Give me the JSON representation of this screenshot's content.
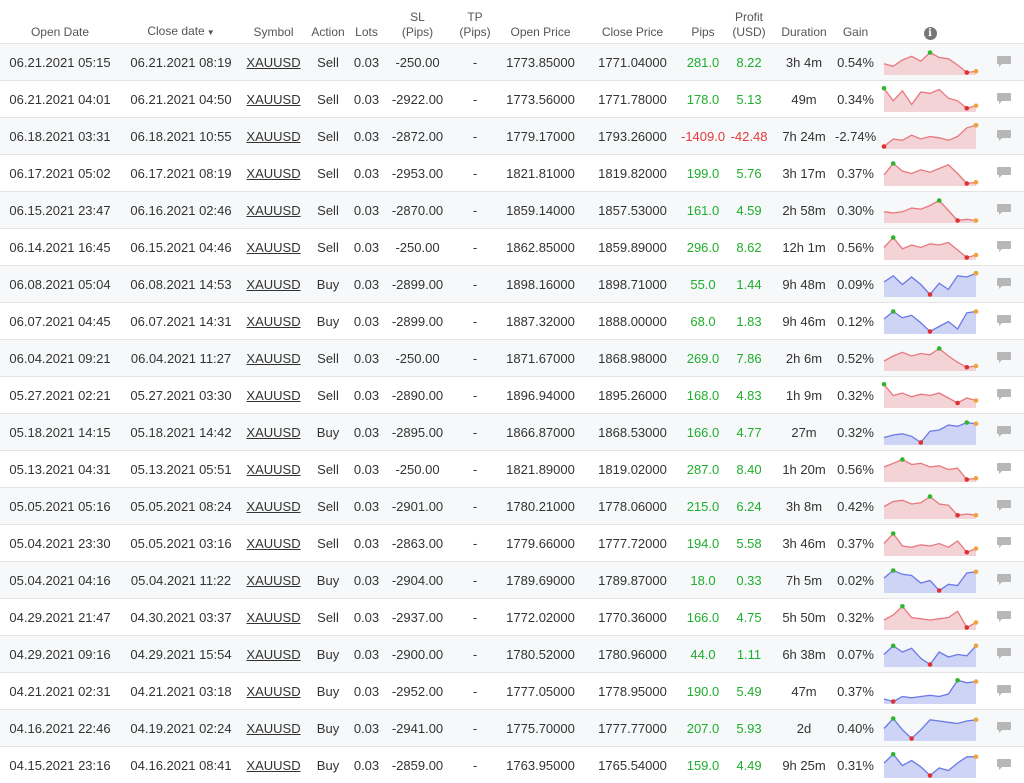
{
  "headers": {
    "open_date": "Open Date",
    "close_date": "Close date",
    "close_sort": "▼",
    "symbol": "Symbol",
    "action": "Action",
    "lots": "Lots",
    "sl_1": "SL",
    "sl_2": "(Pips)",
    "tp_1": "TP",
    "tp_2": "(Pips)",
    "open_price": "Open Price",
    "close_price": "Close Price",
    "pips": "Pips",
    "profit_1": "Profit",
    "profit_2": "(USD)",
    "duration": "Duration",
    "gain": "Gain",
    "info": "i"
  },
  "colors": {
    "profit": "#1fae2e",
    "loss": "#e33a3a",
    "sell_line": "#e8787e",
    "sell_fill": "#f3d3d5",
    "buy_line": "#6b79e6",
    "buy_fill": "#cdd4f6",
    "high_marker": "#2db52d",
    "low_marker": "#e03030",
    "end_marker": "#f2a23a"
  },
  "trades": [
    {
      "open": "06.21.2021 05:15",
      "close": "06.21.2021 08:19",
      "symbol": "XAUUSD",
      "action": "Sell",
      "lots": "0.03",
      "sl": "-250.00",
      "tp": "-",
      "open_price": "1773.85000",
      "close_price": "1771.04000",
      "pips": "281.0",
      "profit": "8.22",
      "duration": "3h 4m",
      "gain": "0.54%",
      "result": "win",
      "spark": [
        0.45,
        0.35,
        0.6,
        0.75,
        0.55,
        0.9,
        0.7,
        0.65,
        0.4,
        0.1,
        0.15
      ]
    },
    {
      "open": "06.21.2021 04:01",
      "close": "06.21.2021 04:50",
      "symbol": "XAUUSD",
      "action": "Sell",
      "lots": "0.03",
      "sl": "-2922.00",
      "tp": "-",
      "open_price": "1773.56000",
      "close_price": "1771.78000",
      "pips": "178.0",
      "profit": "5.13",
      "duration": "49m",
      "gain": "0.34%",
      "result": "win",
      "spark": [
        0.95,
        0.45,
        0.85,
        0.3,
        0.8,
        0.75,
        0.9,
        0.55,
        0.45,
        0.15,
        0.25
      ]
    },
    {
      "open": "06.18.2021 03:31",
      "close": "06.18.2021 10:55",
      "symbol": "XAUUSD",
      "action": "Sell",
      "lots": "0.03",
      "sl": "-2872.00",
      "tp": "-",
      "open_price": "1779.17000",
      "close_price": "1793.26000",
      "pips": "-1409.0",
      "profit": "-42.48",
      "duration": "7h 24m",
      "gain": "-2.74%",
      "result": "loss",
      "spark": [
        0.1,
        0.4,
        0.35,
        0.55,
        0.4,
        0.5,
        0.45,
        0.35,
        0.5,
        0.85,
        0.95
      ]
    },
    {
      "open": "06.17.2021 05:02",
      "close": "06.17.2021 08:19",
      "symbol": "XAUUSD",
      "action": "Sell",
      "lots": "0.03",
      "sl": "-2953.00",
      "tp": "-",
      "open_price": "1821.81000",
      "close_price": "1819.82000",
      "pips": "199.0",
      "profit": "5.76",
      "duration": "3h 17m",
      "gain": "0.37%",
      "result": "win",
      "spark": [
        0.45,
        0.9,
        0.6,
        0.5,
        0.65,
        0.55,
        0.7,
        0.85,
        0.5,
        0.1,
        0.15
      ]
    },
    {
      "open": "06.15.2021 23:47",
      "close": "06.16.2021 02:46",
      "symbol": "XAUUSD",
      "action": "Sell",
      "lots": "0.03",
      "sl": "-2870.00",
      "tp": "-",
      "open_price": "1859.14000",
      "close_price": "1857.53000",
      "pips": "161.0",
      "profit": "4.59",
      "duration": "2h 58m",
      "gain": "0.30%",
      "result": "win",
      "spark": [
        0.45,
        0.4,
        0.45,
        0.6,
        0.55,
        0.7,
        0.9,
        0.5,
        0.1,
        0.15,
        0.1
      ]
    },
    {
      "open": "06.14.2021 16:45",
      "close": "06.15.2021 04:46",
      "symbol": "XAUUSD",
      "action": "Sell",
      "lots": "0.03",
      "sl": "-250.00",
      "tp": "-",
      "open_price": "1862.85000",
      "close_price": "1859.89000",
      "pips": "296.0",
      "profit": "8.62",
      "duration": "12h 1m",
      "gain": "0.56%",
      "result": "win",
      "spark": [
        0.5,
        0.9,
        0.45,
        0.6,
        0.5,
        0.65,
        0.6,
        0.7,
        0.4,
        0.1,
        0.2
      ]
    },
    {
      "open": "06.08.2021 05:04",
      "close": "06.08.2021 14:53",
      "symbol": "XAUUSD",
      "action": "Buy",
      "lots": "0.03",
      "sl": "-2899.00",
      "tp": "-",
      "open_price": "1898.16000",
      "close_price": "1898.71000",
      "pips": "55.0",
      "profit": "1.44",
      "duration": "9h 48m",
      "gain": "0.09%",
      "result": "win",
      "spark": [
        0.6,
        0.85,
        0.5,
        0.8,
        0.5,
        0.1,
        0.55,
        0.3,
        0.85,
        0.8,
        0.95
      ]
    },
    {
      "open": "06.07.2021 04:45",
      "close": "06.07.2021 14:31",
      "symbol": "XAUUSD",
      "action": "Buy",
      "lots": "0.03",
      "sl": "-2899.00",
      "tp": "-",
      "open_price": "1887.32000",
      "close_price": "1888.00000",
      "pips": "68.0",
      "profit": "1.83",
      "duration": "9h 46m",
      "gain": "0.12%",
      "result": "win",
      "spark": [
        0.6,
        0.9,
        0.65,
        0.75,
        0.45,
        0.1,
        0.3,
        0.5,
        0.2,
        0.85,
        0.9
      ]
    },
    {
      "open": "06.04.2021 09:21",
      "close": "06.04.2021 11:27",
      "symbol": "XAUUSD",
      "action": "Sell",
      "lots": "0.03",
      "sl": "-250.00",
      "tp": "-",
      "open_price": "1871.67000",
      "close_price": "1868.98000",
      "pips": "269.0",
      "profit": "7.86",
      "duration": "2h 6m",
      "gain": "0.52%",
      "result": "win",
      "spark": [
        0.4,
        0.6,
        0.75,
        0.6,
        0.7,
        0.65,
        0.9,
        0.6,
        0.35,
        0.15,
        0.2
      ]
    },
    {
      "open": "05.27.2021 02:21",
      "close": "05.27.2021 03:30",
      "symbol": "XAUUSD",
      "action": "Sell",
      "lots": "0.03",
      "sl": "-2890.00",
      "tp": "-",
      "open_price": "1896.94000",
      "close_price": "1895.26000",
      "pips": "168.0",
      "profit": "4.83",
      "duration": "1h 9m",
      "gain": "0.32%",
      "result": "win",
      "spark": [
        0.95,
        0.5,
        0.6,
        0.45,
        0.55,
        0.5,
        0.6,
        0.4,
        0.2,
        0.4,
        0.3
      ]
    },
    {
      "open": "05.18.2021 14:15",
      "close": "05.18.2021 14:42",
      "symbol": "XAUUSD",
      "action": "Buy",
      "lots": "0.03",
      "sl": "-2895.00",
      "tp": "-",
      "open_price": "1866.87000",
      "close_price": "1868.53000",
      "pips": "166.0",
      "profit": "4.77",
      "duration": "27m",
      "gain": "0.32%",
      "result": "win",
      "spark": [
        0.3,
        0.4,
        0.45,
        0.35,
        0.1,
        0.55,
        0.6,
        0.8,
        0.75,
        0.9,
        0.85
      ]
    },
    {
      "open": "05.13.2021 04:31",
      "close": "05.13.2021 05:51",
      "symbol": "XAUUSD",
      "action": "Sell",
      "lots": "0.03",
      "sl": "-250.00",
      "tp": "-",
      "open_price": "1821.89000",
      "close_price": "1819.02000",
      "pips": "287.0",
      "profit": "8.40",
      "duration": "1h 20m",
      "gain": "0.56%",
      "result": "win",
      "spark": [
        0.6,
        0.75,
        0.9,
        0.7,
        0.75,
        0.6,
        0.65,
        0.5,
        0.55,
        0.1,
        0.15
      ]
    },
    {
      "open": "05.05.2021 05:16",
      "close": "05.05.2021 08:24",
      "symbol": "XAUUSD",
      "action": "Sell",
      "lots": "0.03",
      "sl": "-2901.00",
      "tp": "-",
      "open_price": "1780.21000",
      "close_price": "1778.06000",
      "pips": "215.0",
      "profit": "6.24",
      "duration": "3h 8m",
      "gain": "0.42%",
      "result": "win",
      "spark": [
        0.5,
        0.7,
        0.75,
        0.6,
        0.65,
        0.9,
        0.6,
        0.55,
        0.15,
        0.2,
        0.15
      ]
    },
    {
      "open": "05.04.2021 23:30",
      "close": "05.05.2021 03:16",
      "symbol": "XAUUSD",
      "action": "Sell",
      "lots": "0.03",
      "sl": "-2863.00",
      "tp": "-",
      "open_price": "1779.66000",
      "close_price": "1777.72000",
      "pips": "194.0",
      "profit": "5.58",
      "duration": "3h 46m",
      "gain": "0.37%",
      "result": "win",
      "spark": [
        0.5,
        0.9,
        0.4,
        0.35,
        0.45,
        0.4,
        0.5,
        0.35,
        0.6,
        0.15,
        0.3
      ]
    },
    {
      "open": "05.04.2021 04:16",
      "close": "05.04.2021 11:22",
      "symbol": "XAUUSD",
      "action": "Buy",
      "lots": "0.03",
      "sl": "-2904.00",
      "tp": "-",
      "open_price": "1789.69000",
      "close_price": "1789.87000",
      "pips": "18.0",
      "profit": "0.33",
      "duration": "7h 5m",
      "gain": "0.02%",
      "result": "win",
      "spark": [
        0.6,
        0.9,
        0.75,
        0.7,
        0.4,
        0.5,
        0.1,
        0.35,
        0.3,
        0.8,
        0.85
      ]
    },
    {
      "open": "04.29.2021 21:47",
      "close": "04.30.2021 03:37",
      "symbol": "XAUUSD",
      "action": "Sell",
      "lots": "0.03",
      "sl": "-2937.00",
      "tp": "-",
      "open_price": "1772.02000",
      "close_price": "1770.36000",
      "pips": "166.0",
      "profit": "4.75",
      "duration": "5h 50m",
      "gain": "0.32%",
      "result": "win",
      "spark": [
        0.4,
        0.6,
        0.95,
        0.5,
        0.45,
        0.4,
        0.45,
        0.5,
        0.75,
        0.1,
        0.3
      ]
    },
    {
      "open": "04.29.2021 09:16",
      "close": "04.29.2021 15:54",
      "symbol": "XAUUSD",
      "action": "Buy",
      "lots": "0.03",
      "sl": "-2900.00",
      "tp": "-",
      "open_price": "1780.52000",
      "close_price": "1780.96000",
      "pips": "44.0",
      "profit": "1.11",
      "duration": "6h 38m",
      "gain": "0.07%",
      "result": "win",
      "spark": [
        0.5,
        0.85,
        0.6,
        0.75,
        0.35,
        0.1,
        0.6,
        0.4,
        0.5,
        0.45,
        0.85
      ]
    },
    {
      "open": "04.21.2021 02:31",
      "close": "04.21.2021 03:18",
      "symbol": "XAUUSD",
      "action": "Buy",
      "lots": "0.03",
      "sl": "-2952.00",
      "tp": "-",
      "open_price": "1777.05000",
      "close_price": "1778.95000",
      "pips": "190.0",
      "profit": "5.49",
      "duration": "47m",
      "gain": "0.37%",
      "result": "win",
      "spark": [
        0.2,
        0.1,
        0.3,
        0.25,
        0.3,
        0.35,
        0.3,
        0.4,
        0.95,
        0.85,
        0.9
      ]
    },
    {
      "open": "04.16.2021 22:46",
      "close": "04.19.2021 02:24",
      "symbol": "XAUUSD",
      "action": "Buy",
      "lots": "0.03",
      "sl": "-2941.00",
      "tp": "-",
      "open_price": "1775.70000",
      "close_price": "1777.77000",
      "pips": "207.0",
      "profit": "5.93",
      "duration": "2d",
      "gain": "0.40%",
      "result": "win",
      "spark": [
        0.5,
        0.9,
        0.45,
        0.1,
        0.45,
        0.85,
        0.8,
        0.75,
        0.7,
        0.8,
        0.85
      ]
    },
    {
      "open": "04.15.2021 23:16",
      "close": "04.16.2021 08:41",
      "symbol": "XAUUSD",
      "action": "Buy",
      "lots": "0.03",
      "sl": "-2859.00",
      "tp": "-",
      "open_price": "1763.95000",
      "close_price": "1765.54000",
      "pips": "159.0",
      "profit": "4.49",
      "duration": "9h 25m",
      "gain": "0.31%",
      "result": "win",
      "spark": [
        0.6,
        0.95,
        0.5,
        0.7,
        0.45,
        0.1,
        0.4,
        0.3,
        0.6,
        0.85,
        0.85
      ]
    }
  ]
}
